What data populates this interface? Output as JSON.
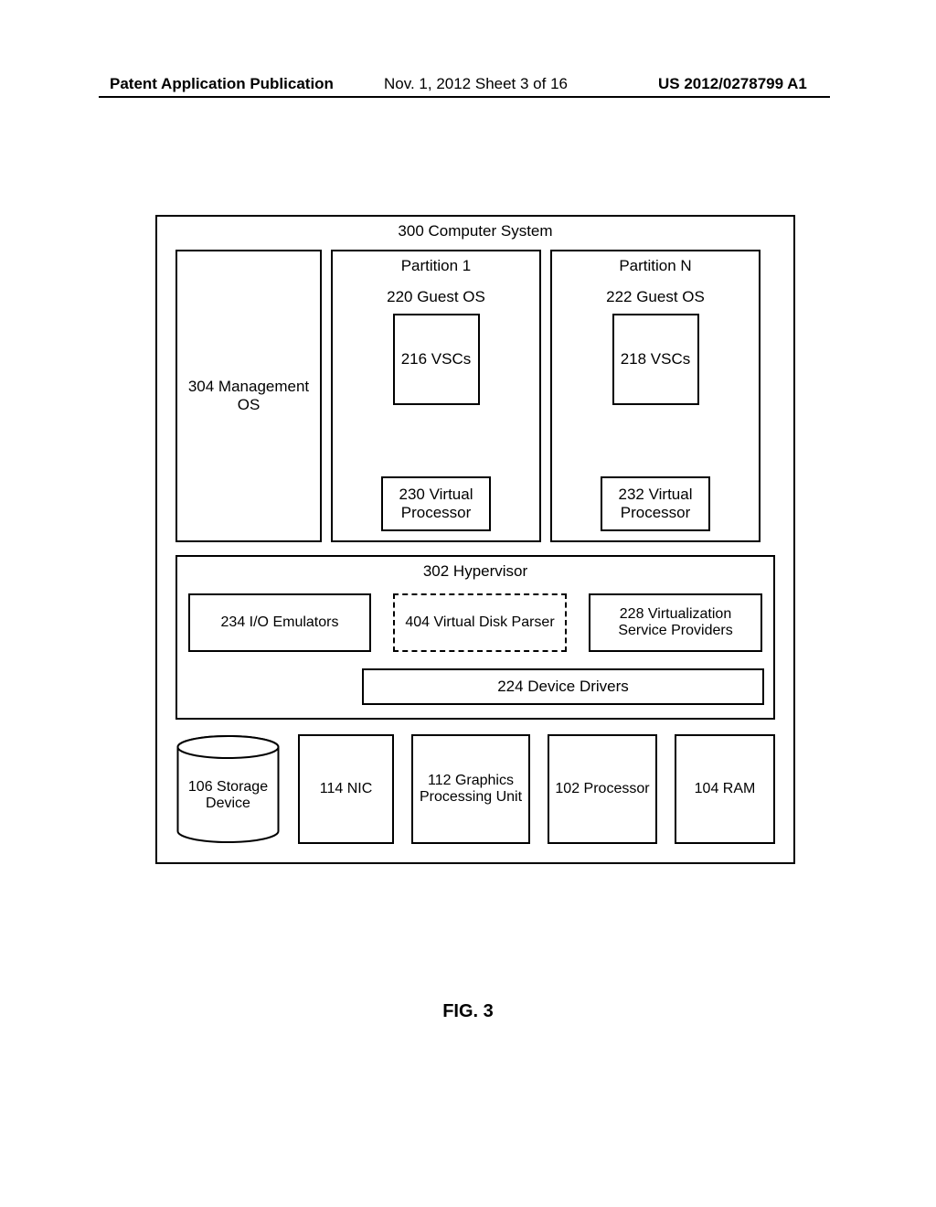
{
  "header": {
    "left": "Patent Application Publication",
    "middle": "Nov. 1, 2012  Sheet 3 of 16",
    "right": "US 2012/0278799 A1"
  },
  "system_title": "300 Computer System",
  "management_os": "304 Management OS",
  "partitions": [
    {
      "title": "Partition 1",
      "guest_os": "220 Guest OS",
      "vsc": "216 VSCs",
      "vproc": "230 Virtual Processor"
    },
    {
      "title": "Partition N",
      "guest_os": "222 Guest OS",
      "vsc": "218 VSCs",
      "vproc": "232 Virtual Processor"
    }
  ],
  "hypervisor": {
    "title": "302 Hypervisor",
    "io_emulators": "234 I/O Emulators",
    "virtual_disk_parser": "404 Virtual Disk Parser",
    "vsp": "228 Virtualization Service Providers",
    "device_drivers": "224 Device Drivers"
  },
  "hardware": {
    "storage": "106 Storage Device",
    "nic": "114 NIC",
    "gpu": "112 Graphics Processing Unit",
    "processor": "102 Processor",
    "ram": "104 RAM"
  },
  "figure_caption": "FIG. 3"
}
